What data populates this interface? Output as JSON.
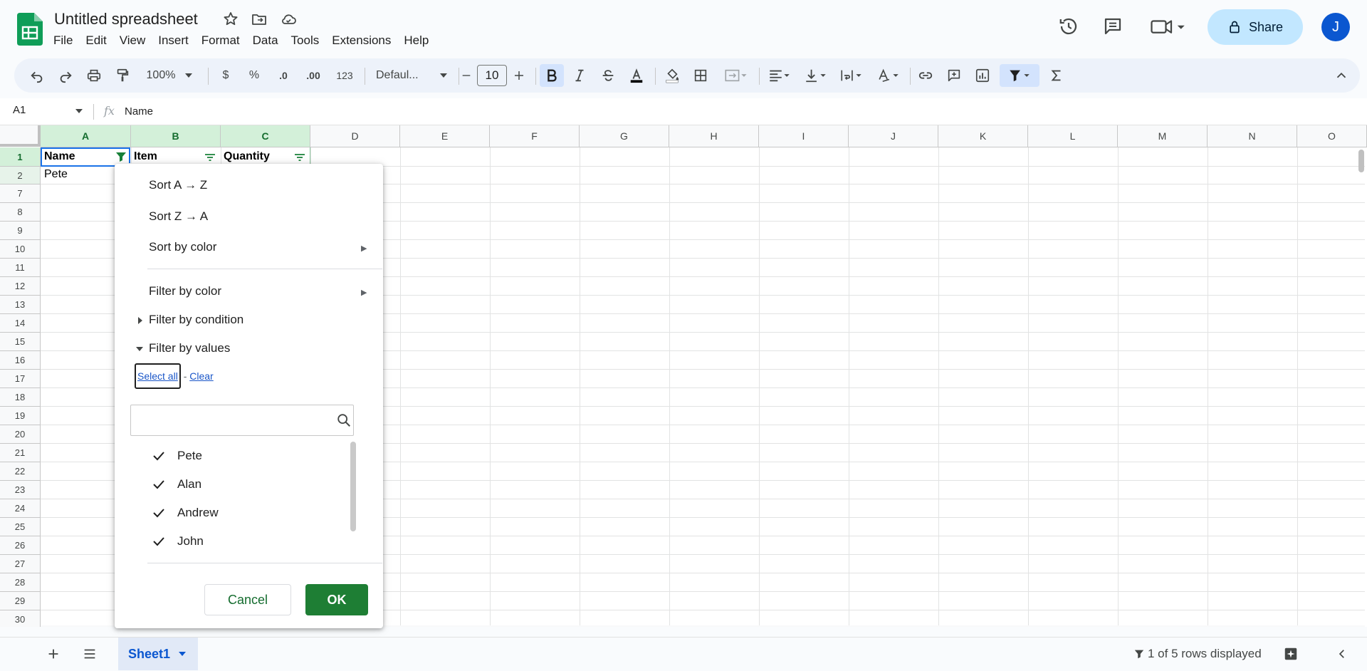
{
  "app": {
    "doc_title": "Untitled spreadsheet",
    "menu": [
      "File",
      "Edit",
      "View",
      "Insert",
      "Format",
      "Data",
      "Tools",
      "Extensions",
      "Help"
    ],
    "share_label": "Share",
    "avatar_initial": "J",
    "brand_color": "#0f9d58"
  },
  "toolbar": {
    "zoom": "100%",
    "currency": "$",
    "percent": "%",
    "decrease_decimal": ".0",
    "increase_decimal": ".00",
    "number_format": "123",
    "font": "Defaul...",
    "font_size": "10"
  },
  "formula_bar": {
    "cell_ref": "A1",
    "fx": "fx",
    "value": "Name"
  },
  "grid": {
    "columns": [
      "A",
      "B",
      "C",
      "D",
      "E",
      "F",
      "G",
      "H",
      "I",
      "J",
      "K",
      "L",
      "M",
      "N",
      "O"
    ],
    "rows": [
      "1",
      "2",
      "7",
      "8",
      "9",
      "10",
      "11",
      "12",
      "13",
      "14",
      "15",
      "16",
      "17",
      "18",
      "19",
      "20",
      "21",
      "22",
      "23",
      "24",
      "25",
      "26",
      "27",
      "28",
      "29",
      "30"
    ],
    "header_row": {
      "a": "Name",
      "b": "Item",
      "c": "Quantity"
    },
    "row2": {
      "a": "Pete"
    }
  },
  "filter_menu": {
    "sort_az": "Sort A → Z",
    "sort_za": "Sort Z → A",
    "sort_by_color": "Sort by color",
    "filter_by_color": "Filter by color",
    "filter_by_condition": "Filter by condition",
    "filter_by_values": "Filter by values",
    "select_all": "Select all",
    "separator": " - ",
    "clear": "Clear",
    "search_placeholder": "",
    "values": [
      "Pete",
      "Alan",
      "Andrew",
      "John"
    ],
    "cancel": "Cancel",
    "ok": "OK",
    "ok_color": "#1e7e34"
  },
  "bottom": {
    "sheet_name": "Sheet1",
    "rows_status": "1 of 5 rows displayed"
  }
}
